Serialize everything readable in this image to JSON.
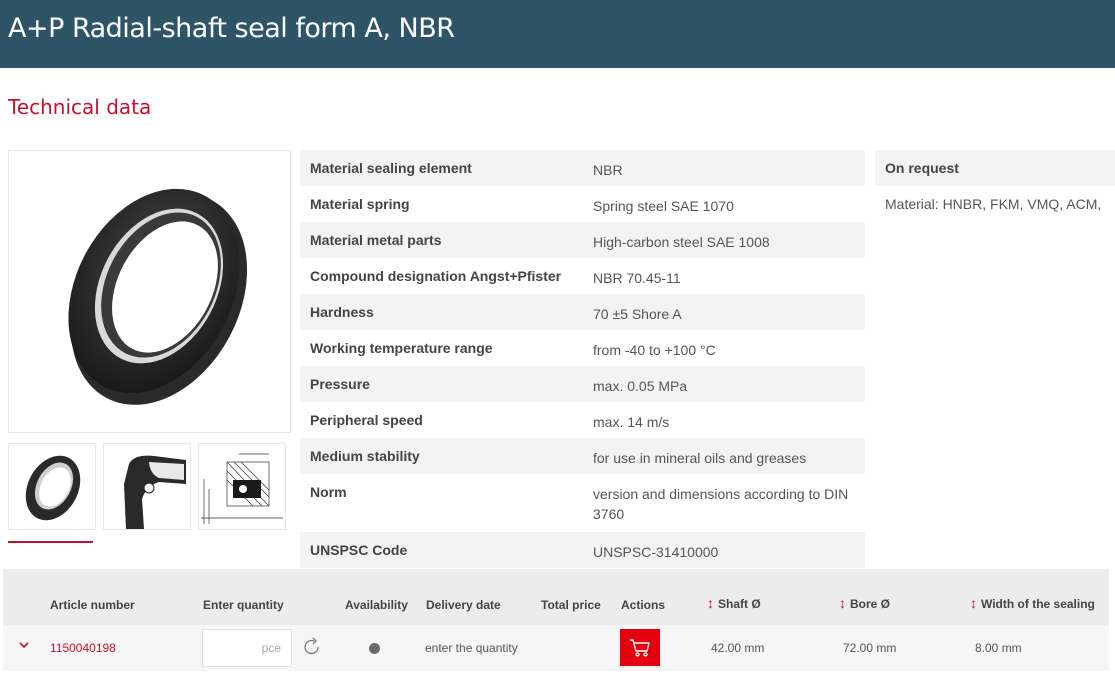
{
  "header": {
    "title": "A+P Radial-shaft seal form A, NBR"
  },
  "section": {
    "title": "Technical data"
  },
  "images": {
    "main": "radial-shaft-seal-image",
    "thumbnails": [
      "seal-front-thumbnail",
      "seal-cross-section-thumbnail",
      "seal-technical-drawing-thumbnail"
    ]
  },
  "specs": [
    {
      "key": "Material sealing element",
      "value": "NBR"
    },
    {
      "key": "Material spring",
      "value": "Spring steel SAE 1070"
    },
    {
      "key": "Material metal parts",
      "value": "High-carbon steel SAE 1008"
    },
    {
      "key": "Compound designation Angst+Pfister",
      "value": "NBR 70.45-11"
    },
    {
      "key": "Hardness",
      "value": "70 ±5 Shore A"
    },
    {
      "key": "Working temperature range",
      "value": "from -40 to +100 °C"
    },
    {
      "key": "Pressure",
      "value": "max. 0.05 MPa"
    },
    {
      "key": "Peripheral speed",
      "value": "max. 14 m/s"
    },
    {
      "key": "Medium stability",
      "value": "for use in mineral oils and greases"
    },
    {
      "key": "Norm",
      "value": "version and dimensions according to DIN 3760"
    },
    {
      "key": "UNSPSC Code",
      "value": "UNSPSC-31410000"
    }
  ],
  "on_request": {
    "title": "On request",
    "text": "Material: HNBR, FKM, VMQ, ACM,"
  },
  "article_table": {
    "headers": {
      "article_number": "Article number",
      "enter_quantity": "Enter quantity",
      "availability": "Availability",
      "delivery_date": "Delivery date",
      "total_price": "Total price",
      "actions": "Actions",
      "shaft": "Shaft Ø",
      "bore": "Bore Ø",
      "width": "Width of the sealing"
    },
    "row": {
      "article_number": "1150040198",
      "quantity_placeholder": "pce",
      "delivery_date": "enter the quantity",
      "shaft": "42.00 mm",
      "bore": "72.00 mm",
      "width": "8.00 mm"
    }
  },
  "colors": {
    "header_bg": "#2e5468",
    "accent_red": "#c8102e",
    "cart_red": "#e3000f"
  }
}
